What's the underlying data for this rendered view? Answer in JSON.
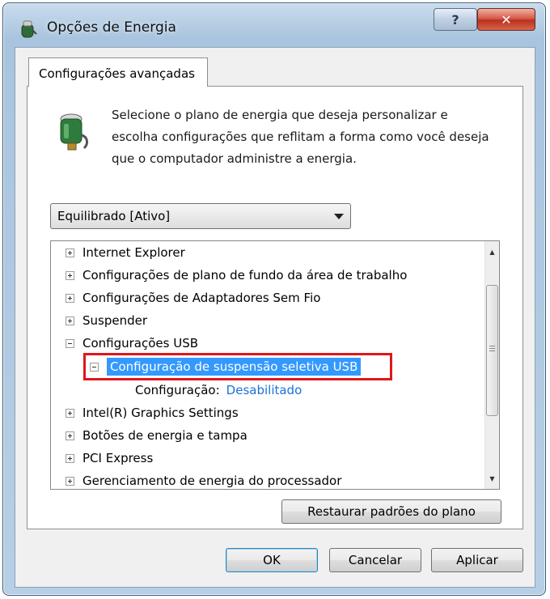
{
  "window": {
    "title": "Opções de Energia",
    "icon": "power-plug-icon"
  },
  "caption_buttons": {
    "help": "?",
    "close": "✕"
  },
  "tab": {
    "label": "Configurações avançadas"
  },
  "intro": {
    "text": "Selecione o plano de energia que deseja personalizar e escolha configurações que reflitam a forma como você deseja que o computador administre a energia."
  },
  "plan_select": {
    "value": "Equilibrado [Ativo]"
  },
  "tree": {
    "items": [
      {
        "label": "Internet Explorer",
        "expander": "plus"
      },
      {
        "label": "Configurações de plano de fundo da área de trabalho",
        "expander": "plus"
      },
      {
        "label": "Configurações de Adaptadores Sem Fio",
        "expander": "plus"
      },
      {
        "label": "Suspender",
        "expander": "plus"
      },
      {
        "label": "Configurações USB",
        "expander": "minus"
      },
      {
        "label": "Configuração de suspensão seletiva USB",
        "expander": "minus",
        "selected": true
      },
      {
        "label": "Configuração:",
        "value": "Desabilitado"
      },
      {
        "label": "Intel(R) Graphics Settings",
        "expander": "plus"
      },
      {
        "label": "Botões de energia e tampa",
        "expander": "plus"
      },
      {
        "label": "PCI Express",
        "expander": "plus"
      },
      {
        "label": "Gerenciamento de energia do processador",
        "expander": "plus"
      }
    ]
  },
  "buttons": {
    "restore": "Restaurar padrões do plano",
    "ok": "OK",
    "cancel": "Cancelar",
    "apply": "Aplicar"
  },
  "colors": {
    "selection": "#3399ff",
    "highlight_border": "#e0161b",
    "link": "#1a73d9"
  }
}
